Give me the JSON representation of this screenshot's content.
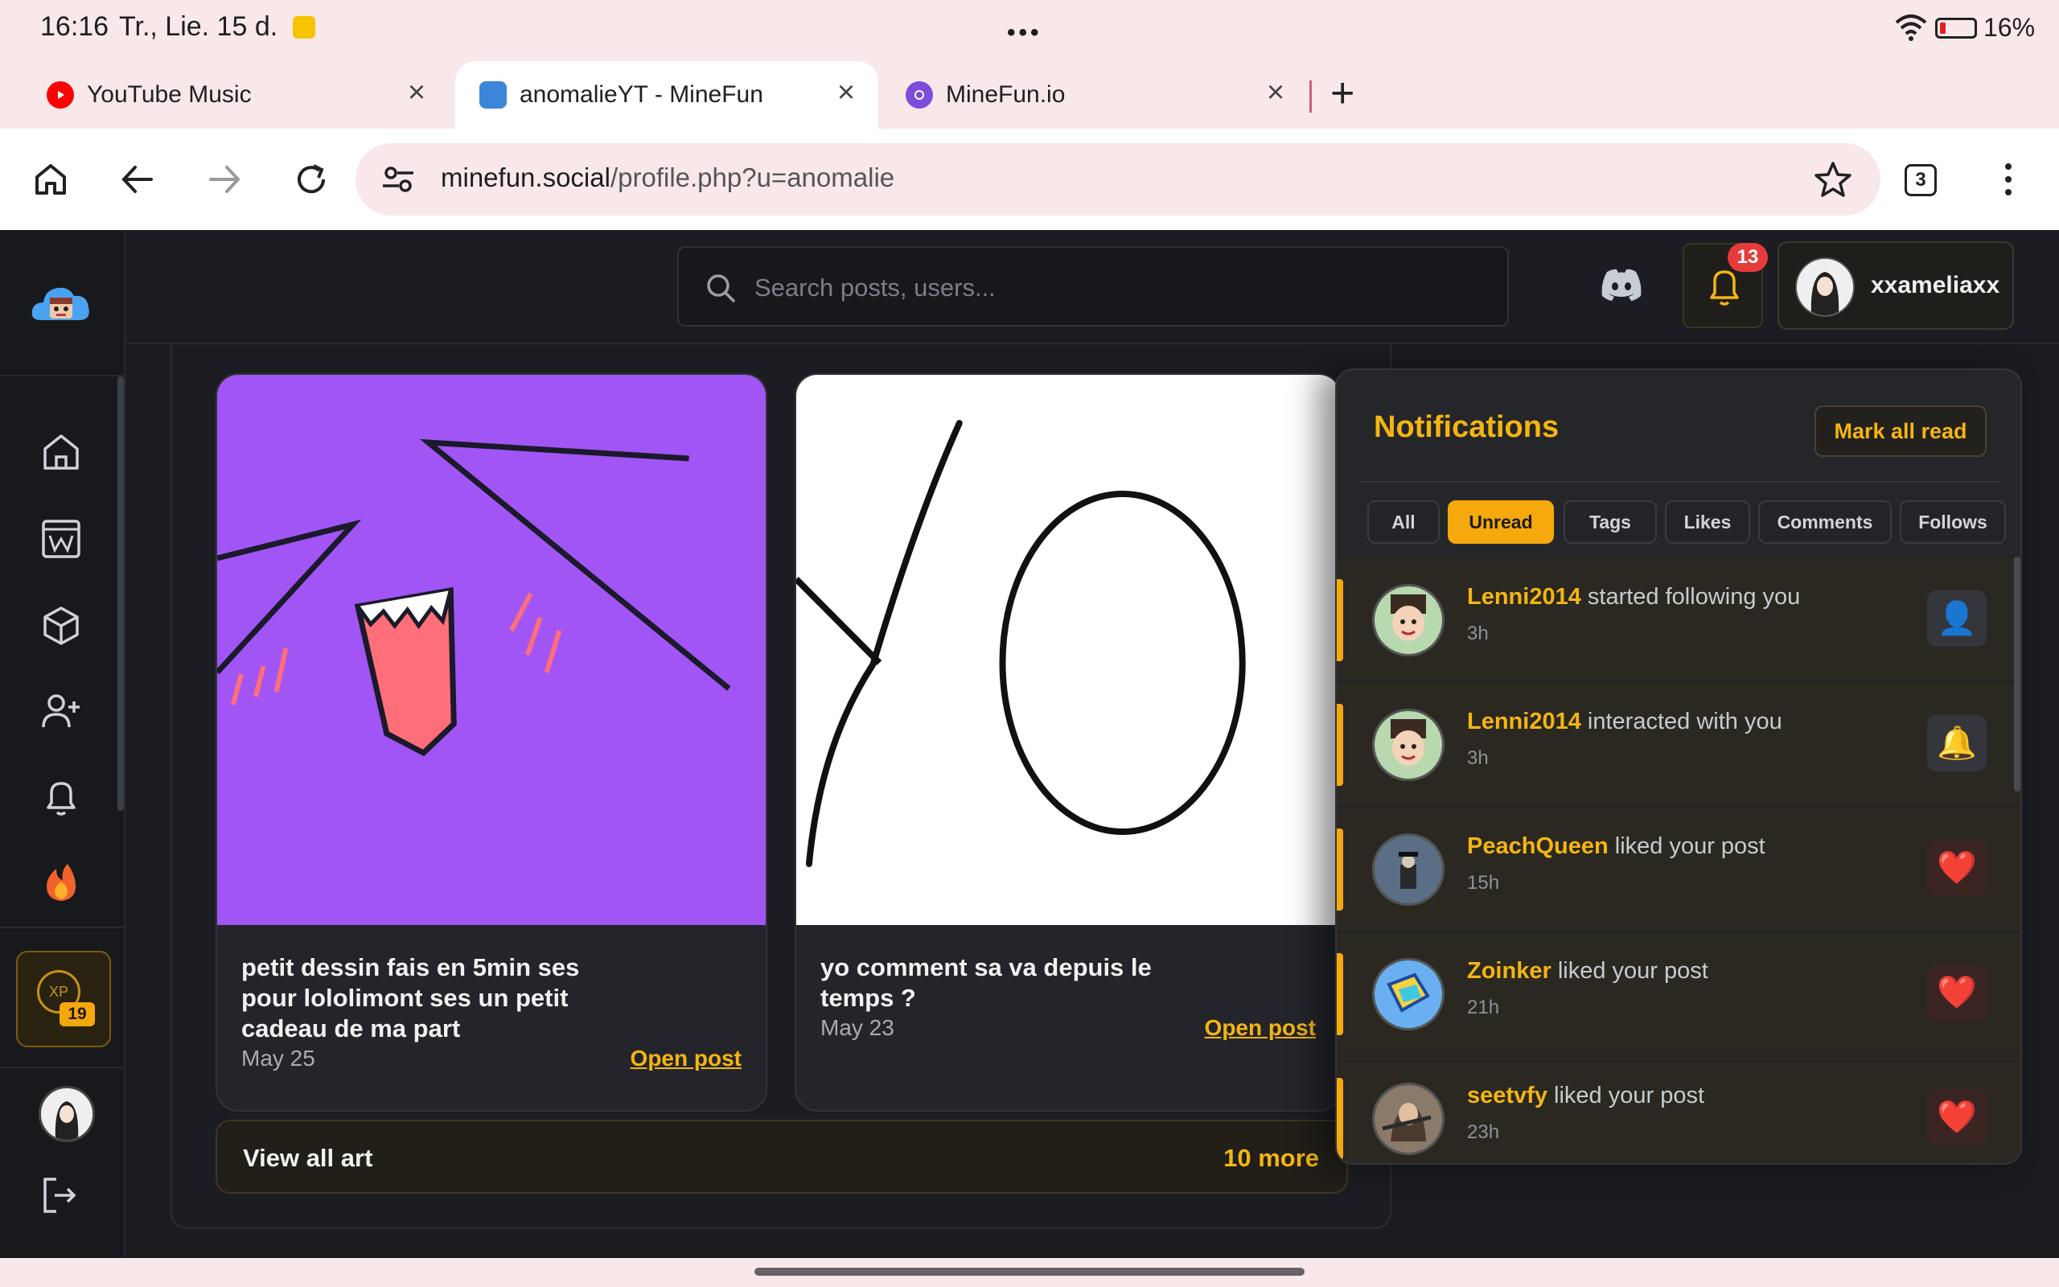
{
  "status": {
    "time": "16:16",
    "date": "Tr., Lie. 15 d.",
    "battery": "16%"
  },
  "tabs": [
    {
      "title": "YouTube Music",
      "favicon_color": "#ff0000"
    },
    {
      "title": "anomalieYT - MineFun",
      "favicon_color": "#3b86d8"
    },
    {
      "title": "MineFun.io",
      "favicon_color": "#7c4ddb"
    }
  ],
  "toolbar": {
    "url_host": "minefun.social",
    "url_path": "/profile.php?u=anomalie",
    "tab_count": "3"
  },
  "header": {
    "search_placeholder": "Search posts, users...",
    "notification_count": "13",
    "username": "xxameliaxx"
  },
  "sidebar": {
    "xp_label": "XP",
    "level": "19",
    "items": [
      "home",
      "wiki",
      "cube",
      "add-user",
      "bell",
      "fire"
    ]
  },
  "posts": [
    {
      "title": "petit dessin fais en 5min ses pour lololimont ses un petit cadeau de ma part",
      "date": "May 25",
      "link": "Open post"
    },
    {
      "title": "yo comment sa va depuis le temps ?",
      "date": "May 23",
      "link": "Open post"
    }
  ],
  "view_all": {
    "label": "View all art",
    "more": "10 more"
  },
  "notifications": {
    "title": "Notifications",
    "mark_all": "Mark all read",
    "filters": [
      "All",
      "Unread",
      "Tags",
      "Likes",
      "Comments",
      "Follows"
    ],
    "active_filter": "Unread",
    "items": [
      {
        "user": "Lenni2014",
        "action": "started following you",
        "ago": "3h",
        "icon": "👤",
        "type": "follow"
      },
      {
        "user": "Lenni2014",
        "action": "interacted with you",
        "ago": "3h",
        "icon": "🔔",
        "type": "bell"
      },
      {
        "user": "PeachQueen",
        "action": "liked your post",
        "ago": "15h",
        "icon": "❤️",
        "type": "like"
      },
      {
        "user": "Zoinker",
        "action": "liked your post",
        "ago": "21h",
        "icon": "❤️",
        "type": "like"
      },
      {
        "user": "seetvfy",
        "action": "liked your post",
        "ago": "23h",
        "icon": "❤️",
        "type": "like"
      }
    ]
  },
  "colors": {
    "accent": "#f4b512",
    "purple_art": "#a155f5"
  }
}
